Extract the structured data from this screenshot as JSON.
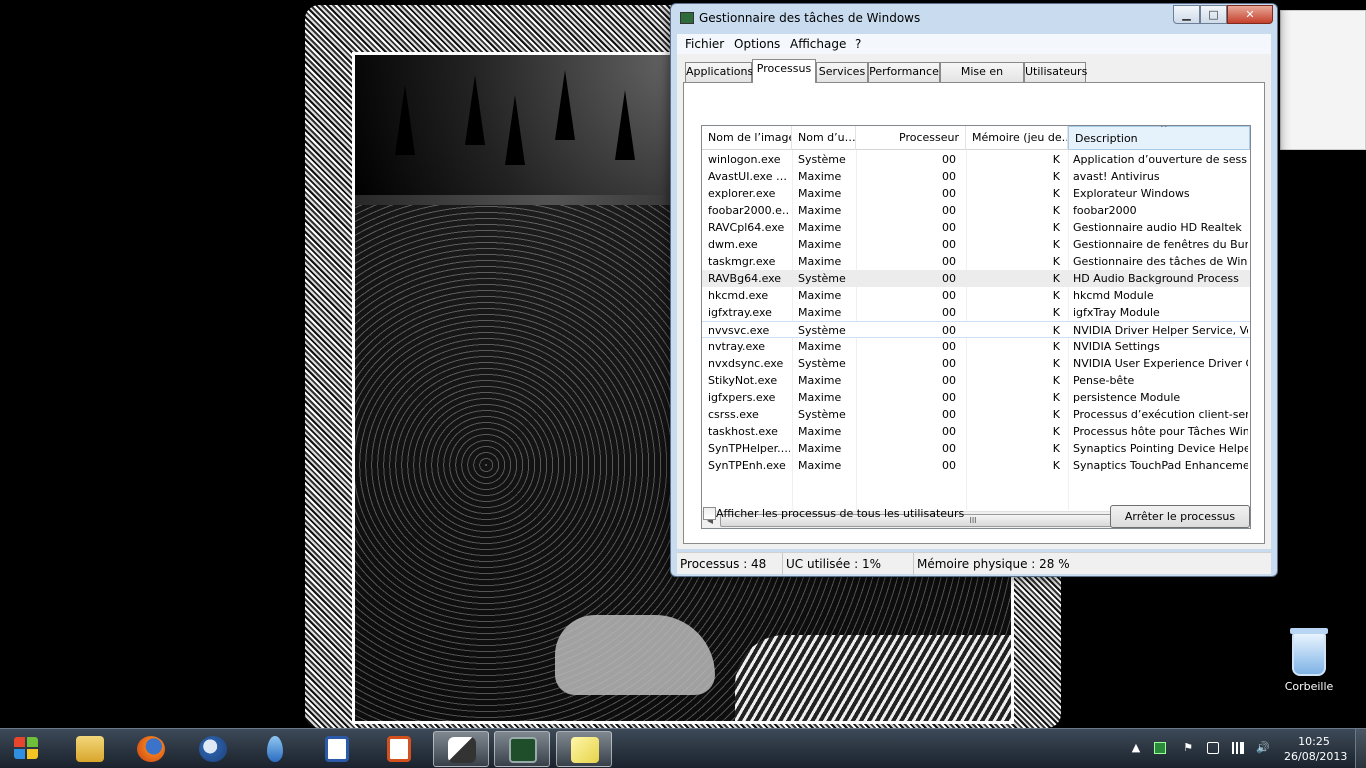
{
  "window": {
    "title": "Gestionnaire des tâches de Windows",
    "min_glyph": "▁",
    "max_glyph": "□",
    "close_glyph": "✕"
  },
  "menu": [
    "Fichier",
    "Options",
    "Affichage",
    "?"
  ],
  "tabs": [
    "Applications",
    "Processus",
    "Services",
    "Performance",
    "Mise en réseau",
    "Utilisateurs"
  ],
  "active_tab": "Processus",
  "columns": {
    "name": "Nom de l’image",
    "user": "Nom d’u…",
    "cpu": "Processeur",
    "mem": "Mémoire (jeu de…",
    "desc": "Description"
  },
  "sort_indicator": "^",
  "processes": [
    {
      "name": "winlogon.exe",
      "user": "Système",
      "cpu": "00",
      "mem": "K",
      "desc": "Application d’ouverture de sessio…"
    },
    {
      "name": "AvastUI.exe …",
      "user": "Maxime",
      "cpu": "00",
      "mem": "K",
      "desc": "avast! Antivirus"
    },
    {
      "name": "explorer.exe",
      "user": "Maxime",
      "cpu": "00",
      "mem": "K",
      "desc": "Explorateur Windows"
    },
    {
      "name": "foobar2000.e…",
      "user": "Maxime",
      "cpu": "00",
      "mem": "K",
      "desc": "foobar2000"
    },
    {
      "name": "RAVCpl64.exe",
      "user": "Maxime",
      "cpu": "00",
      "mem": "K",
      "desc": "Gestionnaire audio HD Realtek"
    },
    {
      "name": "dwm.exe",
      "user": "Maxime",
      "cpu": "00",
      "mem": "K",
      "desc": "Gestionnaire de fenêtres du Bureau"
    },
    {
      "name": "taskmgr.exe",
      "user": "Maxime",
      "cpu": "00",
      "mem": "K",
      "desc": "Gestionnaire des tâches de Windo…"
    },
    {
      "name": "RAVBg64.exe",
      "user": "Système",
      "cpu": "00",
      "mem": "K",
      "desc": "HD Audio Background Process"
    },
    {
      "name": "hkcmd.exe",
      "user": "Maxime",
      "cpu": "00",
      "mem": "K",
      "desc": "hkcmd Module"
    },
    {
      "name": "igfxtray.exe",
      "user": "Maxime",
      "cpu": "00",
      "mem": "K",
      "desc": "igfxTray Module"
    },
    {
      "name": "nvvsvc.exe",
      "user": "Système",
      "cpu": "00",
      "mem": "K",
      "desc": "NVIDIA Driver Helper Service, Ver…"
    },
    {
      "name": "nvtray.exe",
      "user": "Maxime",
      "cpu": "00",
      "mem": "K",
      "desc": "NVIDIA Settings"
    },
    {
      "name": "nvxdsync.exe",
      "user": "Système",
      "cpu": "00",
      "mem": "K",
      "desc": "NVIDIA User Experience Driver C…"
    },
    {
      "name": "StikyNot.exe",
      "user": "Maxime",
      "cpu": "00",
      "mem": "K",
      "desc": "Pense-bête"
    },
    {
      "name": "igfxpers.exe",
      "user": "Maxime",
      "cpu": "00",
      "mem": "K",
      "desc": "persistence Module"
    },
    {
      "name": "csrss.exe",
      "user": "Système",
      "cpu": "00",
      "mem": "K",
      "desc": "Processus d’exécution client-serveur"
    },
    {
      "name": "taskhost.exe",
      "user": "Maxime",
      "cpu": "00",
      "mem": "K",
      "desc": "Processus hôte pour Tâches Wind…"
    },
    {
      "name": "SynTPHelper.…",
      "user": "Maxime",
      "cpu": "00",
      "mem": "K",
      "desc": "Synaptics Pointing Device Helper"
    },
    {
      "name": "SynTPEnh.exe",
      "user": "Maxime",
      "cpu": "00",
      "mem": "K",
      "desc": "Synaptics TouchPad Enhancements"
    }
  ],
  "scrollbar": {
    "left_arrow": "◀",
    "right_arrow": "▶",
    "grip": "III"
  },
  "show_all_label": "Afficher les processus de tous les utilisateurs",
  "end_process_label": "Arrêter le processus",
  "status": {
    "processes": "Processus : 48",
    "cpu": "UC utilisée : 1%",
    "memory": "Mémoire physique : 28 %"
  },
  "desktop": {
    "recycle_bin": "Corbeille"
  },
  "clock": {
    "time": "10:25",
    "date": "26/08/2013"
  },
  "tray_glyphs": {
    "expand": "▲",
    "flag": "⚑",
    "volume": "🔊"
  },
  "colors": {
    "accent": "#c9dcef",
    "close": "#c4402b",
    "selection": "#e6f2fb"
  }
}
